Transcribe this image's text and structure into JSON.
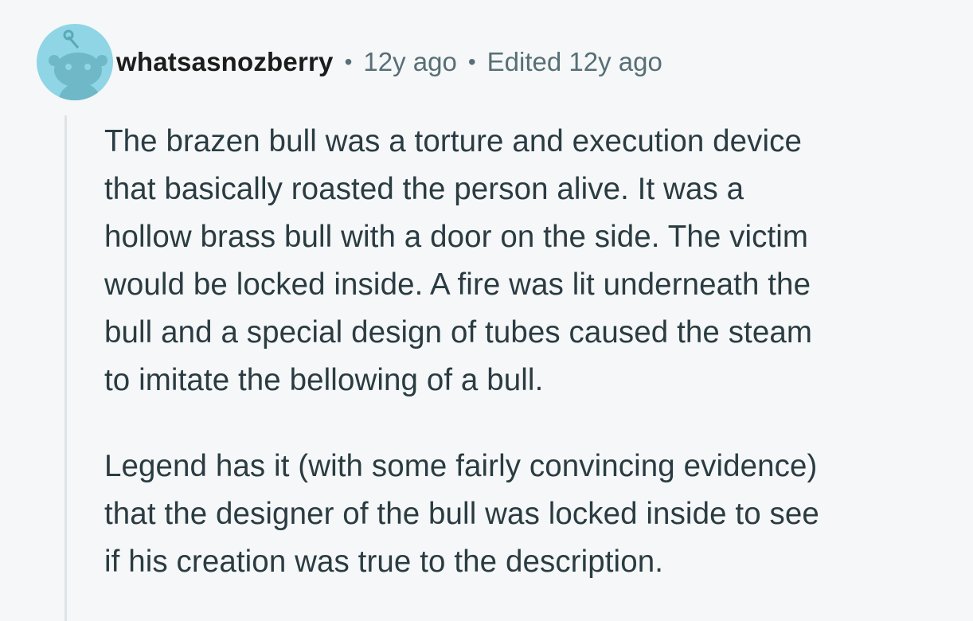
{
  "comment": {
    "author": "whatsasnozberry",
    "separator": "•",
    "time": "12y ago",
    "edited": "Edited 12y ago",
    "avatar_icon": "snoo-avatar-icon",
    "avatar_color": "#8fd5e5",
    "paragraphs": [
      {
        "lines": [
          "The brazen bull was a torture and execution device",
          "that basically roasted the person alive. It was a",
          "hollow brass bull with a door on the side. The victim",
          "would be locked inside. A fire was lit underneath the",
          "bull and a special design of tubes caused the steam",
          "to imitate the bellowing of a bull."
        ]
      },
      {
        "lines": [
          "Legend has it (with some fairly convincing evidence)",
          "that the designer of the bull was locked inside to see",
          "if his creation was true to the description."
        ]
      }
    ]
  }
}
